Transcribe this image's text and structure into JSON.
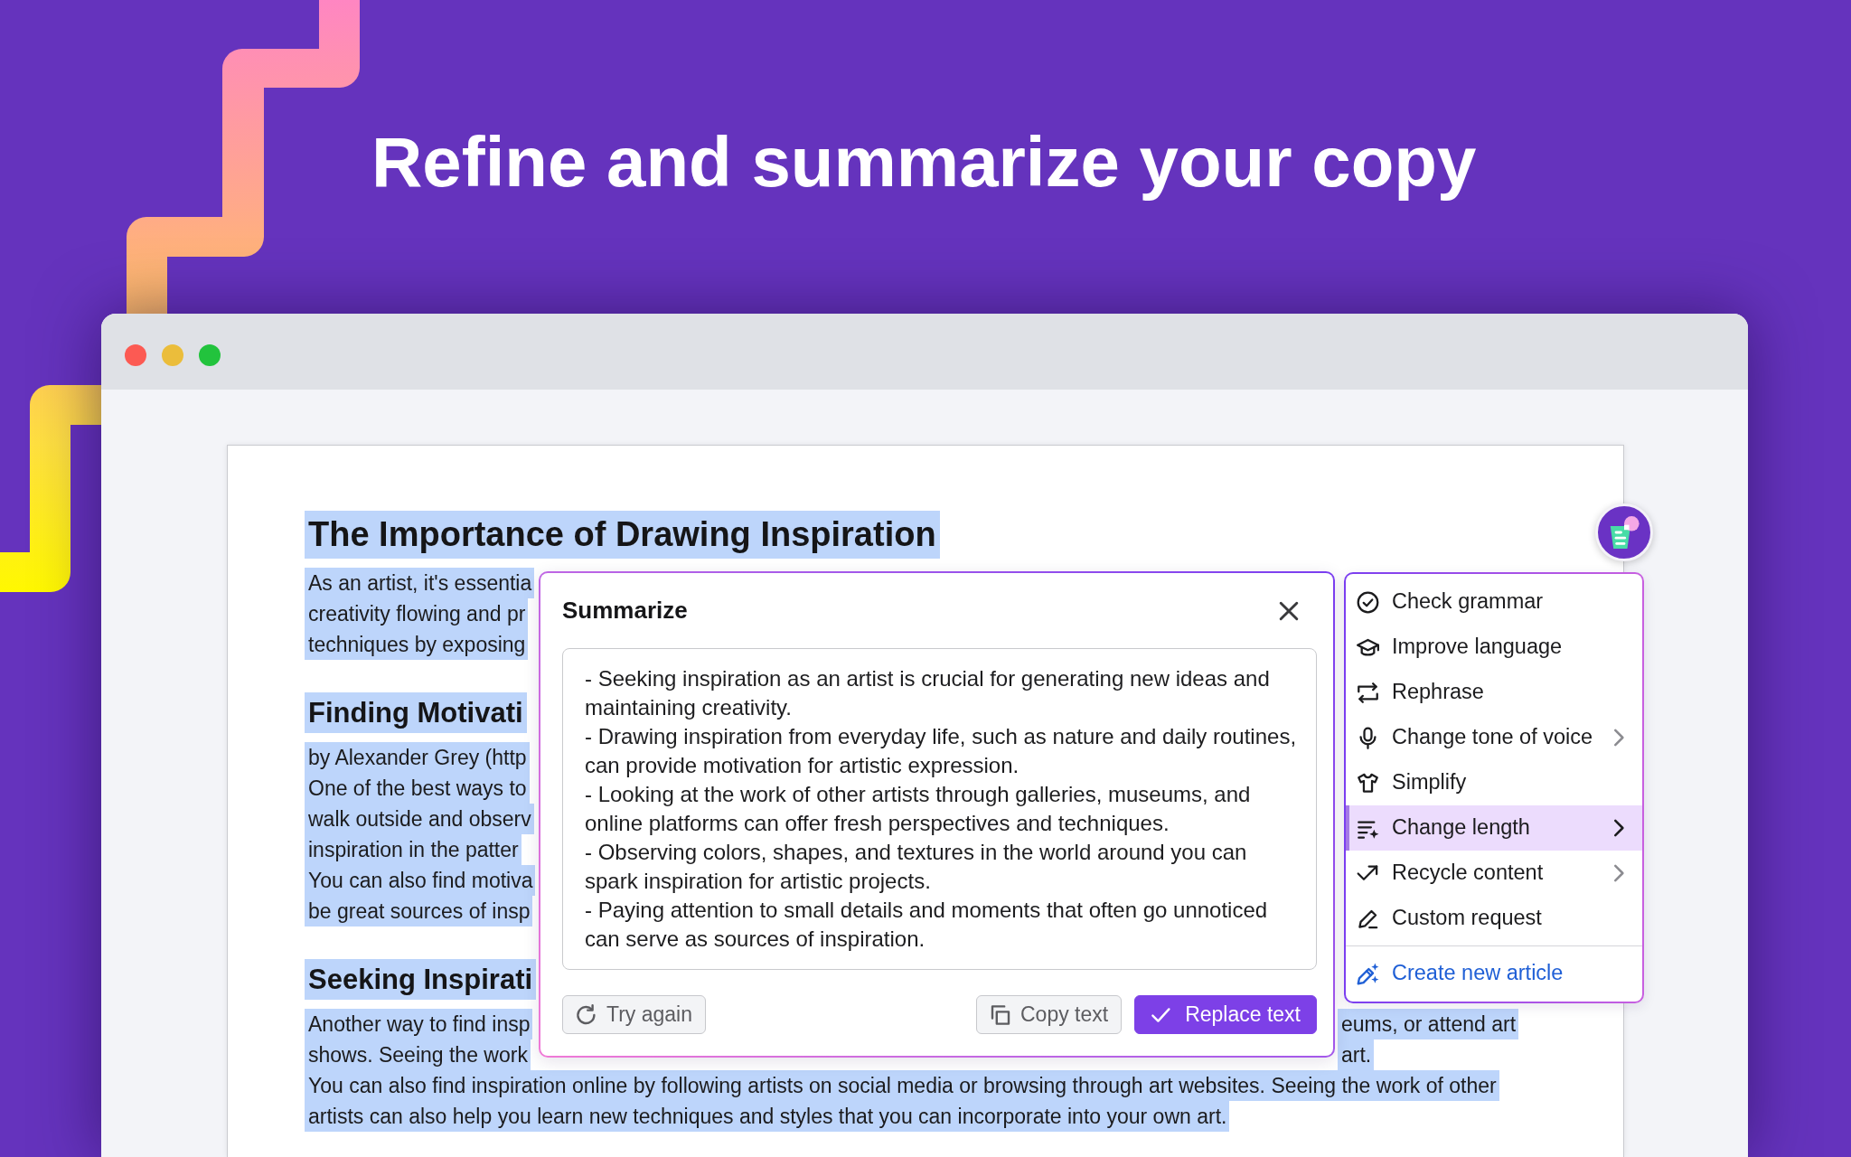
{
  "headline": "Refine and summarize your copy",
  "document": {
    "text_selected": true,
    "blocks": [
      {
        "kind": "title",
        "text": "The Importance of Drawing Inspiration"
      },
      {
        "kind": "paragraph",
        "lines": [
          [
            "As an artist, it's essentia"
          ],
          [
            "creativity flowing and pr"
          ],
          [
            "techniques by exposing"
          ]
        ]
      },
      {
        "kind": "heading",
        "text": "Finding Motivati"
      },
      {
        "kind": "paragraph",
        "lines": [
          [
            "by Alexander Grey (http"
          ],
          [
            "One of the best ways to"
          ],
          [
            "walk outside and observ"
          ],
          [
            "inspiration in the patter"
          ],
          [
            "You can also find motiva"
          ],
          [
            "be great sources of insp"
          ]
        ]
      },
      {
        "kind": "heading",
        "text": "Seeking Inspirati"
      },
      {
        "kind": "paragraph",
        "lines": [
          [
            "Another way to find insp",
            "eums, or attend art"
          ],
          [
            "shows. Seeing the work",
            "art."
          ],
          [
            "You can also find inspiration online by following artists on social media or browsing through art websites. Seeing the work of other"
          ],
          [
            "artists can also help you learn new techniques and styles that you can incorporate into your own art."
          ]
        ]
      }
    ]
  },
  "dialog": {
    "title": "Summarize",
    "summary_points": [
      "- Seeking inspiration as an artist is crucial for generating new ideas and maintaining creativity.",
      "- Drawing inspiration from everyday life, such as nature and daily routines, can provide motivation for artistic expression.",
      "- Looking at the work of other artists through galleries, museums, and online platforms can offer fresh perspectives and techniques.",
      "- Observing colors, shapes, and textures in the world around you can spark inspiration for artistic projects.",
      "- Paying attention to small details and moments that often go unnoticed can serve as sources of inspiration."
    ],
    "buttons": [
      {
        "label": "Try again",
        "kind": "secondary"
      },
      {
        "label": "Copy text",
        "kind": "secondary"
      },
      {
        "label": "Replace text",
        "kind": "primary"
      }
    ]
  },
  "menu": {
    "items": [
      {
        "label": "Check grammar",
        "submenu": false,
        "selected": false
      },
      {
        "label": "Improve language",
        "submenu": false,
        "selected": false
      },
      {
        "label": "Rephrase",
        "submenu": false,
        "selected": false
      },
      {
        "label": "Change tone of voice",
        "submenu": true,
        "selected": false
      },
      {
        "label": "Simplify",
        "submenu": false,
        "selected": false
      },
      {
        "label": "Change length",
        "submenu": true,
        "selected": true
      },
      {
        "label": "Recycle content",
        "submenu": true,
        "selected": false
      },
      {
        "label": "Custom request",
        "submenu": false,
        "selected": false
      }
    ],
    "footer_action": {
      "label": "Create new article"
    }
  }
}
